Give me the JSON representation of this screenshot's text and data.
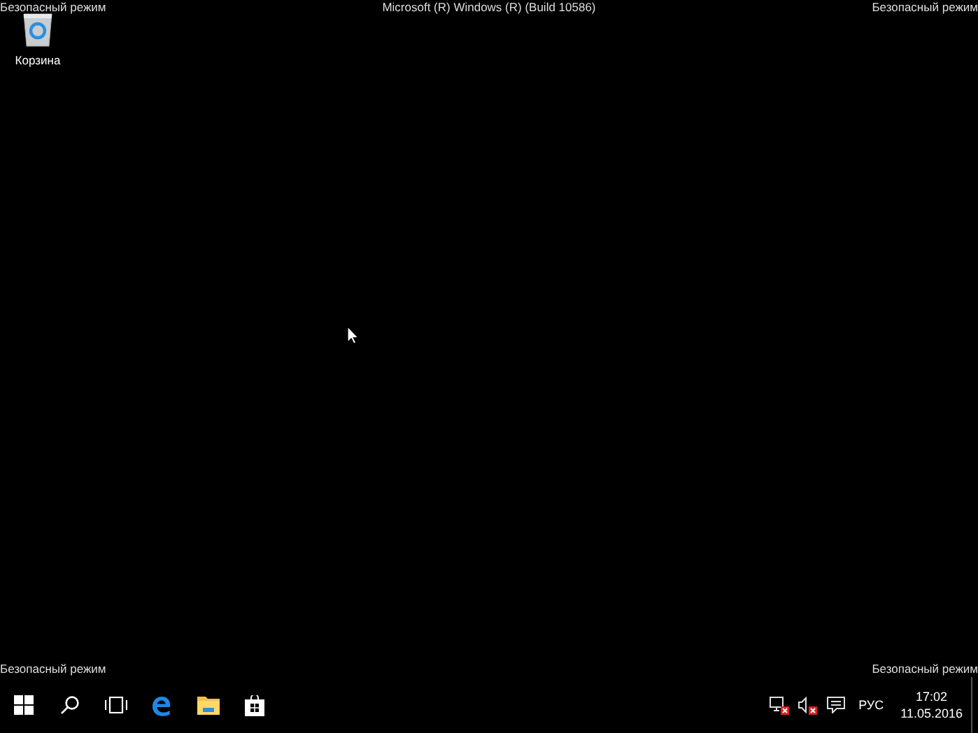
{
  "overlay_labels": {
    "top_left": "Безопасный режим",
    "top_center": "Microsoft (R) Windows (R) (Build 10586)",
    "top_right": "Безопасный режим",
    "bottom_left": "Безопасный режим",
    "bottom_right": "Безопасный режим"
  },
  "desktop_icons": [
    {
      "kind": "recycle-bin",
      "label": "Корзина"
    }
  ],
  "taskbar": {
    "buttons": [
      {
        "kind": "start"
      },
      {
        "kind": "search"
      },
      {
        "kind": "task-view"
      },
      {
        "kind": "edge"
      },
      {
        "kind": "explorer"
      },
      {
        "kind": "store"
      }
    ],
    "tray_icons": [
      {
        "kind": "network"
      },
      {
        "kind": "volume"
      },
      {
        "kind": "notifications"
      }
    ],
    "language": "РУС",
    "time": "17:02",
    "date": "11.05.2016"
  }
}
